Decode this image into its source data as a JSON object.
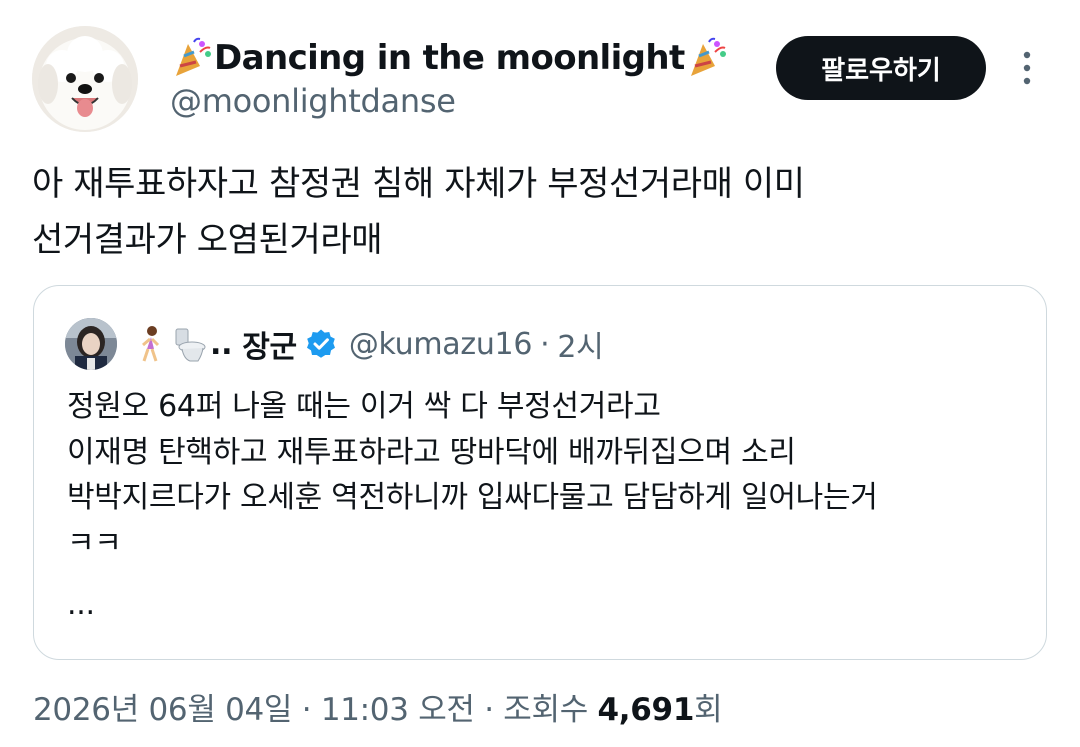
{
  "author": {
    "display_name": "Dancing in the moonlight",
    "handle": "@moonlightdanse",
    "follow_label": "팔로우하기"
  },
  "tweet": {
    "lines": [
      "아 재투표하자고 참정권 침해 자체가 부정선거라매 이미",
      "선거결과가 오염된거라매"
    ]
  },
  "quote": {
    "name_prefix": "..",
    "name": "장군",
    "handle": "@kumazu16",
    "dot": "·",
    "time": "2시",
    "lines": [
      "정원오 64퍼 나올 때는 이거 싹 다 부정선거라고",
      "이재명 탄핵하고 재투표하라고 땅바닥에 배까뒤집으며 소리",
      "박박지르다가 오세훈 역전하니까 입싸다물고 담담하게 일어나는거",
      "ㅋㅋ",
      "..."
    ]
  },
  "meta": {
    "date_time": "2026년 06월 04일 · 11:03 오전 · 조회수 ",
    "views": "4,691",
    "views_suffix": "회"
  },
  "colors": {
    "text": "#0f1419",
    "secondary": "#536471",
    "verified_blue": "#1d9bf0",
    "border": "#cfd9de"
  },
  "icons": {
    "party_popper": "party-popper-icon",
    "verified": "verified-badge-icon",
    "more": "more-vertical-icon"
  }
}
